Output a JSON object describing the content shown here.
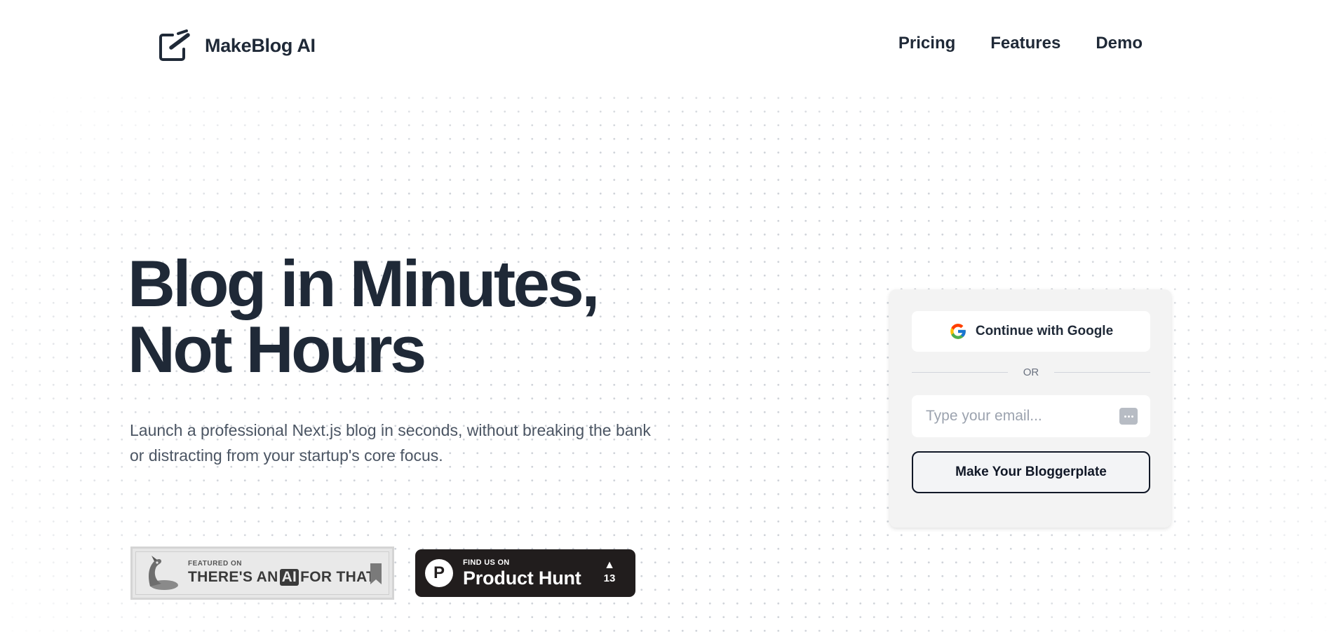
{
  "brand": {
    "name": "MakeBlog AI",
    "logo_icon": "edit-square-icon"
  },
  "nav": {
    "items": [
      {
        "label": "Pricing"
      },
      {
        "label": "Features"
      },
      {
        "label": "Demo"
      }
    ]
  },
  "hero": {
    "title_line1": "Blog in Minutes,",
    "title_line2": "Not Hours",
    "subtitle": "Launch a professional Next.js blog in seconds, without breaking the bank or distracting from your startup's core focus."
  },
  "badges": {
    "aift": {
      "small": "FEATURED ON",
      "big_before": "THERE'S AN",
      "big_ai": "AI",
      "big_after": "FOR THAT"
    },
    "producthunt": {
      "logo_letter": "P",
      "small": "FIND US ON",
      "big": "Product Hunt",
      "upvote_arrow": "▲",
      "votes": "13"
    }
  },
  "signup": {
    "google_label": "Continue with Google",
    "divider_text": "OR",
    "email_placeholder": "Type your email...",
    "submit_label": "Make Your Bloggerplate"
  },
  "colors": {
    "text_dark": "#1f2937",
    "text_muted": "#4b5563",
    "card_bg": "#f3f3f3",
    "producthunt_bg": "#211d1d"
  }
}
